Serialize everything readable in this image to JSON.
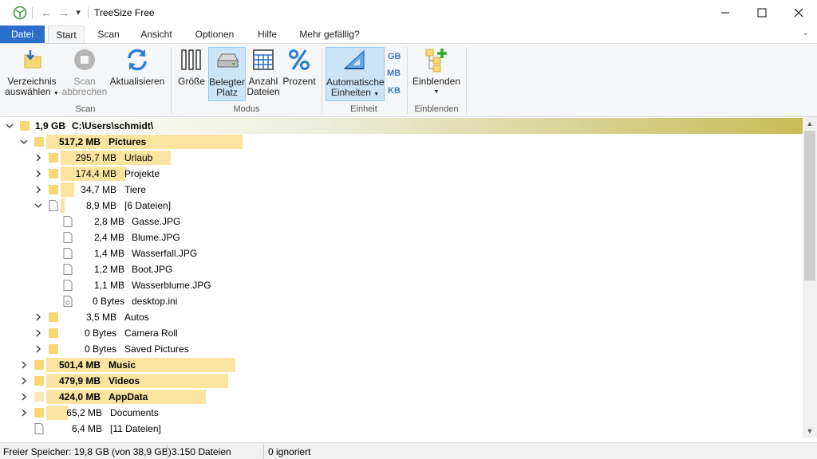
{
  "window": {
    "title": "TreeSize Free",
    "minimize": "–",
    "maximize": "☐",
    "close": "✕"
  },
  "toolbar_quick": {
    "back": "←",
    "forward": "→",
    "customize": "▾"
  },
  "tabs": [
    {
      "label": "Datei"
    },
    {
      "label": "Start"
    },
    {
      "label": "Scan"
    },
    {
      "label": "Ansicht"
    },
    {
      "label": "Optionen"
    },
    {
      "label": "Hilfe"
    },
    {
      "label": "Mehr gefällig?"
    }
  ],
  "ribbon": {
    "collapse": "⌄",
    "scan_group": {
      "label": "Scan",
      "select_dir": {
        "line1": "Verzeichnis",
        "line2": "auswählen"
      },
      "cancel_scan": {
        "line1": "Scan",
        "line2": "abbrechen"
      },
      "refresh": {
        "line1": "Aktualisieren"
      }
    },
    "mode_group": {
      "label": "Modus",
      "size": {
        "line1": "Größe"
      },
      "allocated": {
        "line1": "Belegter",
        "line2": "Platz"
      },
      "file_count": {
        "line1": "Anzahl",
        "line2": "Dateien"
      },
      "percent": {
        "line1": "Prozent"
      }
    },
    "unit_group": {
      "label": "Einheit",
      "auto_units": {
        "line1": "Automatische",
        "line2": "Einheiten"
      },
      "gb": "GB",
      "mb": "MB",
      "kb": "KB"
    },
    "show_group": {
      "label": "Einblenden",
      "show": {
        "line1": "Einblenden"
      }
    }
  },
  "tree": {
    "root": {
      "size": "1,9 GB",
      "name": "C:\\Users\\schmidt\\"
    },
    "rows": [
      {
        "size": "517,2 MB",
        "name": "Pictures",
        "bar_fraction": 0.27
      },
      {
        "size": "295,7 MB",
        "name": "Urlaub",
        "bar_fraction": 0.57
      },
      {
        "size": "174,4 MB",
        "name": "Projekte",
        "bar_fraction": 0.34
      },
      {
        "size": "34,7 MB",
        "name": "Tiere",
        "bar_fraction": 0.07
      },
      {
        "size": "8,9 MB",
        "name": "[6 Dateien]",
        "bar_fraction": 0.02
      },
      {
        "size": "2,8 MB",
        "name": "Gasse.JPG"
      },
      {
        "size": "2,4 MB",
        "name": "Blume.JPG"
      },
      {
        "size": "1,4 MB",
        "name": "Wasserfall.JPG"
      },
      {
        "size": "1,2 MB",
        "name": "Boot.JPG"
      },
      {
        "size": "1,1 MB",
        "name": "Wasserblume.JPG"
      },
      {
        "size": "0 Bytes",
        "name": "desktop.ini"
      },
      {
        "size": "3,5 MB",
        "name": "Autos"
      },
      {
        "size": "0 Bytes",
        "name": "Camera Roll"
      },
      {
        "size": "0 Bytes",
        "name": "Saved Pictures"
      },
      {
        "size": "501,4 MB",
        "name": "Music",
        "bar_fraction": 0.26
      },
      {
        "size": "479,9 MB",
        "name": "Videos",
        "bar_fraction": 0.25
      },
      {
        "size": "424,0 MB",
        "name": "AppData",
        "bar_fraction": 0.22
      },
      {
        "size": "65,2 MB",
        "name": "Documents",
        "bar_fraction": 0.03
      },
      {
        "size": "6,4 MB",
        "name": "[11 Dateien]"
      }
    ]
  },
  "scrollbar": {
    "up": "▲",
    "down": "▼"
  },
  "status": {
    "free_space": "Freier Speicher: 19,8 GB  (von 38,9 GB)",
    "files": "3.150 Dateien",
    "ignored": "0 ignoriert"
  },
  "colors": {
    "accent": "#2b6ecb",
    "bar": "#fbe4a0",
    "folder": "#f8d775",
    "root_gradient_end": "#c8bb55"
  }
}
